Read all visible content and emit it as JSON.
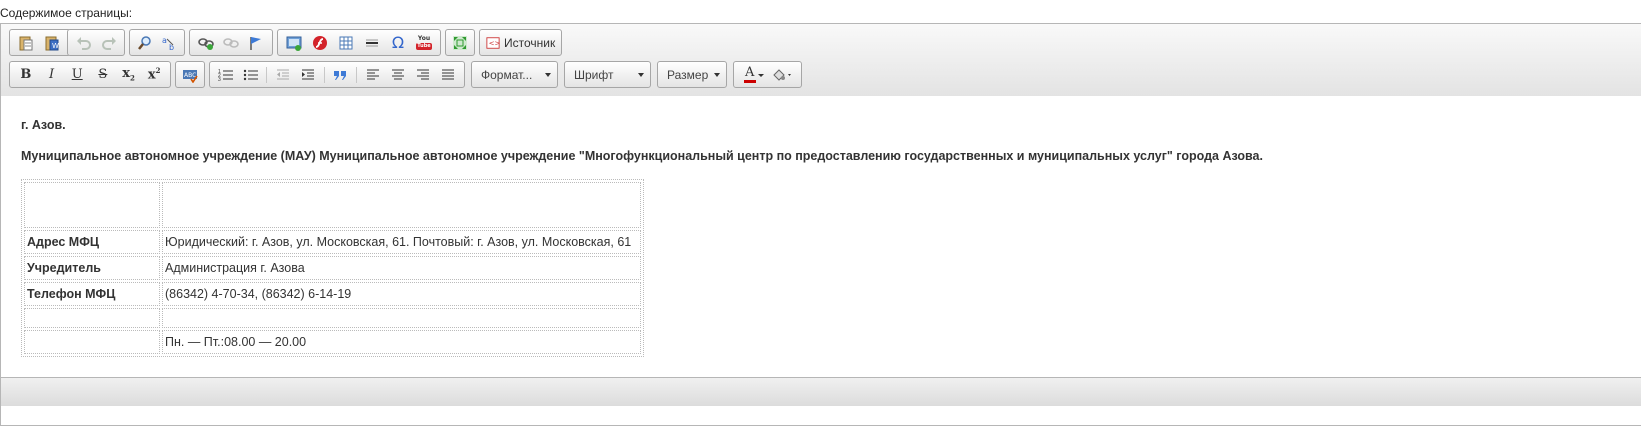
{
  "field_label": "Содержимое страницы:",
  "toolbar": {
    "source_label": "Источник",
    "format_label": "Формат...",
    "font_label": "Шрифт",
    "size_label": "Размер",
    "bold": "B",
    "italic": "I",
    "underline": "U",
    "strike": "S",
    "sub_base": "x",
    "sub_mark": "2",
    "sup_base": "x",
    "sup_mark": "2",
    "special_char": "Ω",
    "youtube_top": "You",
    "youtube_bottom": "Tube",
    "text_color_letter": "A"
  },
  "content": {
    "city": "г. Азов.",
    "org": "Муниципальное автономное учреждение (МАУ) Муниципальное автономное учреждение \"Многофункциональный центр по предоставлению государственных и муниципальных услуг\" города Азова.",
    "rows": [
      {
        "key": "",
        "value": ""
      },
      {
        "key": "Адрес МФЦ",
        "value": "Юридический: г. Азов, ул. Московская, 61. Почтовый: г. Азов, ул. Московская, 61"
      },
      {
        "key": "Учредитель",
        "value": "Администрация г. Азова"
      },
      {
        "key": "Телефон МФЦ",
        "value": "(86342) 4-70-34, (86342) 6-14-19"
      },
      {
        "key": "",
        "value": ""
      },
      {
        "key": "",
        "value": "Пн. — Пт.:08.00 — 20.00"
      }
    ]
  },
  "colors": {
    "toolbar_bg": "#e9e9e9",
    "border": "#b6b6b6",
    "text_color_bar": "#cc0000"
  }
}
